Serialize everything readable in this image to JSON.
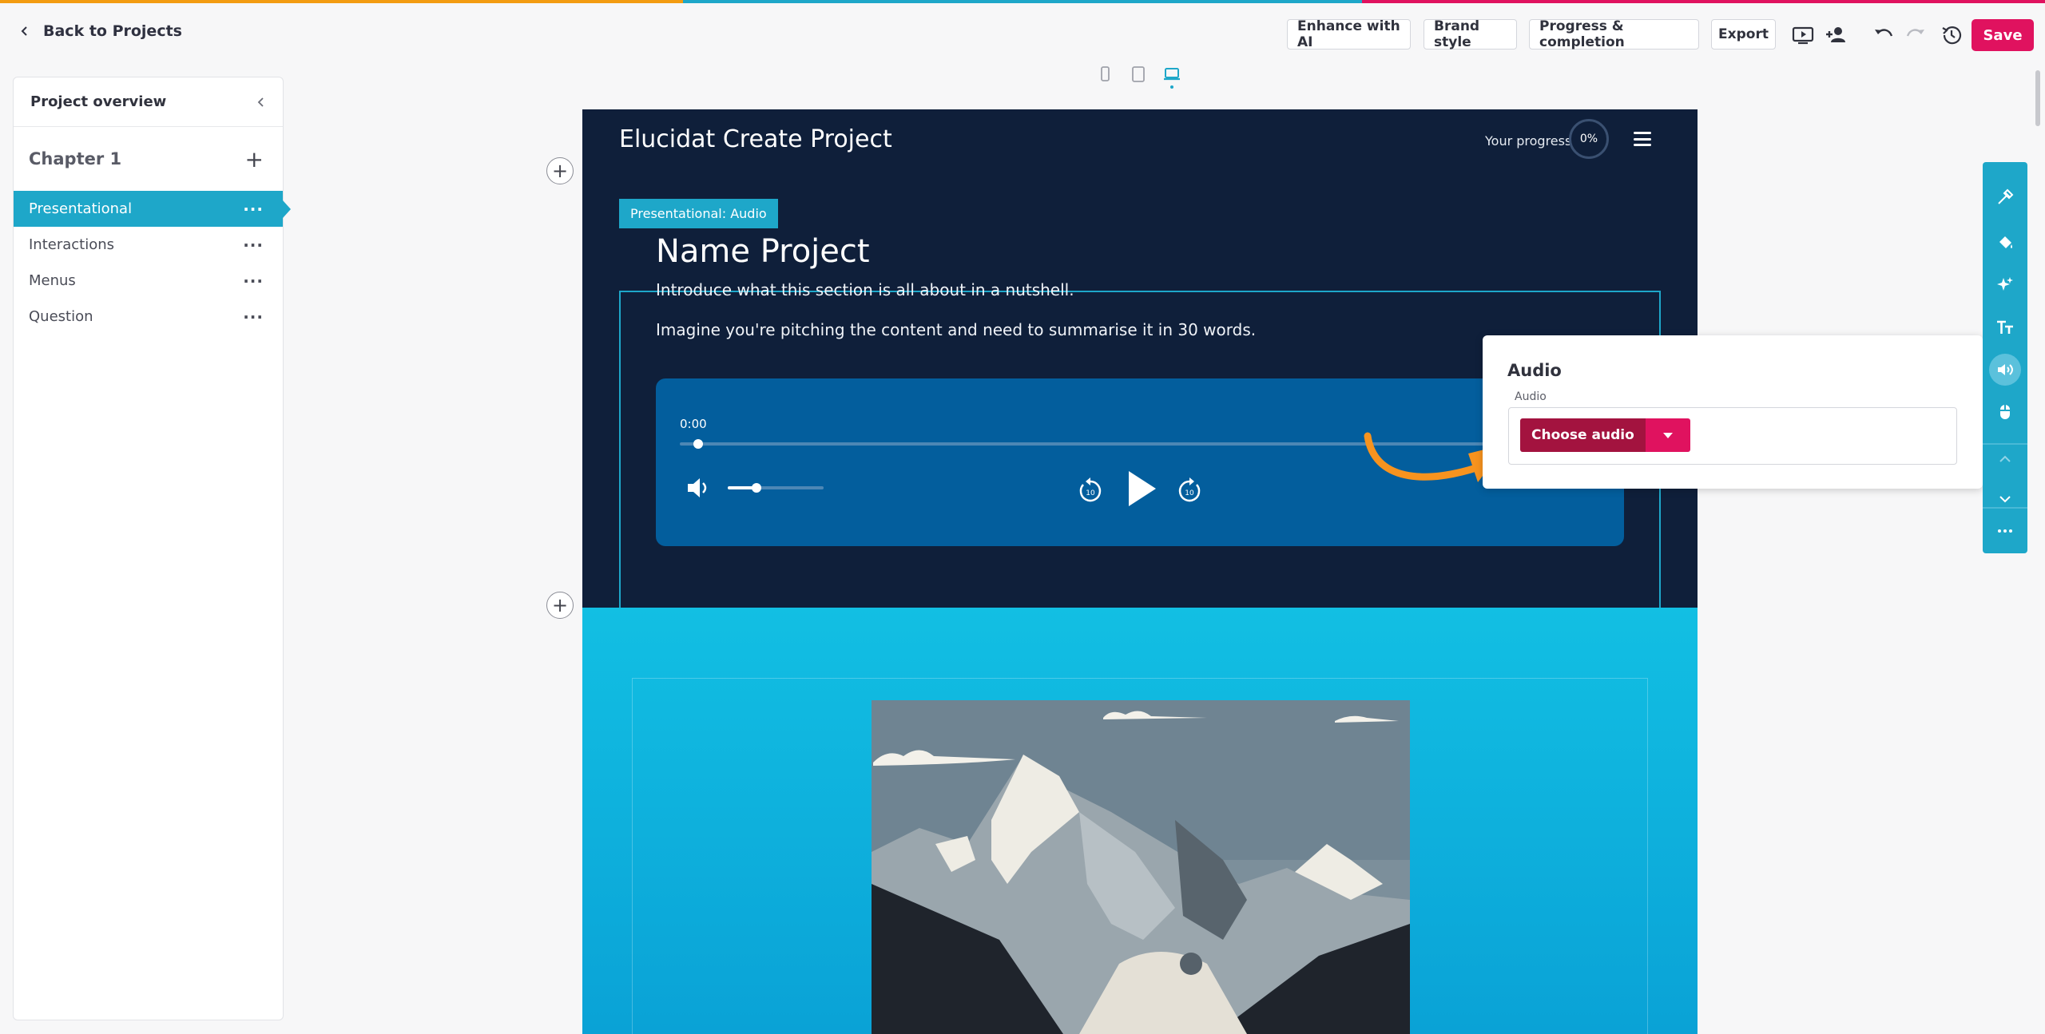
{
  "colors": {
    "stripe_orange": "#f39c12",
    "stripe_teal": "#1ea7c9",
    "stripe_pink": "#e0125f",
    "accent_teal": "#1ea7c9",
    "save_pink": "#e0125f",
    "choose_crimson": "#a3133f",
    "dark_navy": "#0f1f3a",
    "player_blue": "#035e9d",
    "arrow_orange": "#f7931e"
  },
  "topbar": {
    "back_label": "Back to Projects",
    "buttons": {
      "enhance": "Enhance with AI",
      "brand": "Brand style",
      "progress": "Progress & completion",
      "export": "Export"
    },
    "icons": [
      "preview-icon",
      "add-user-icon",
      "undo-icon",
      "redo-icon",
      "history-icon"
    ],
    "save_label": "Save"
  },
  "device_switch": {
    "options": [
      "mobile-icon",
      "tablet-icon",
      "desktop-icon"
    ],
    "selected": "desktop"
  },
  "sidebar": {
    "title": "Project overview",
    "chapter": "Chapter 1",
    "pages": [
      {
        "label": "Presentational",
        "active": true
      },
      {
        "label": "Interactions",
        "active": false
      },
      {
        "label": "Menus",
        "active": false
      },
      {
        "label": "Question",
        "active": false
      }
    ]
  },
  "canvas": {
    "project_title": "Elucidat Create Project",
    "progress_label": "Your progress",
    "progress_value": "0%",
    "selected_tag": "Presentational: Audio",
    "section_title": "Name Project",
    "paragraph_1": "Introduce what this section is all about in a nutshell.",
    "paragraph_2": "Imagine you're pitching the content and need to summarise it in 30 words.",
    "player": {
      "time": "0:00",
      "playback_fraction": 0.02,
      "volume_fraction": 0.3,
      "rewind_seconds": "10",
      "forward_seconds": "10"
    }
  },
  "audio_panel": {
    "title": "Audio",
    "field_label": "Audio",
    "choose_label": "Choose audio"
  },
  "right_toolbar": {
    "tools": [
      "eyedropper-icon",
      "paint-bucket-icon",
      "sparkles-icon",
      "text-size-icon",
      "audio-icon",
      "mouse-icon",
      "chevron-up-icon",
      "chevron-down-icon",
      "more-icon"
    ],
    "active": "audio-icon"
  }
}
